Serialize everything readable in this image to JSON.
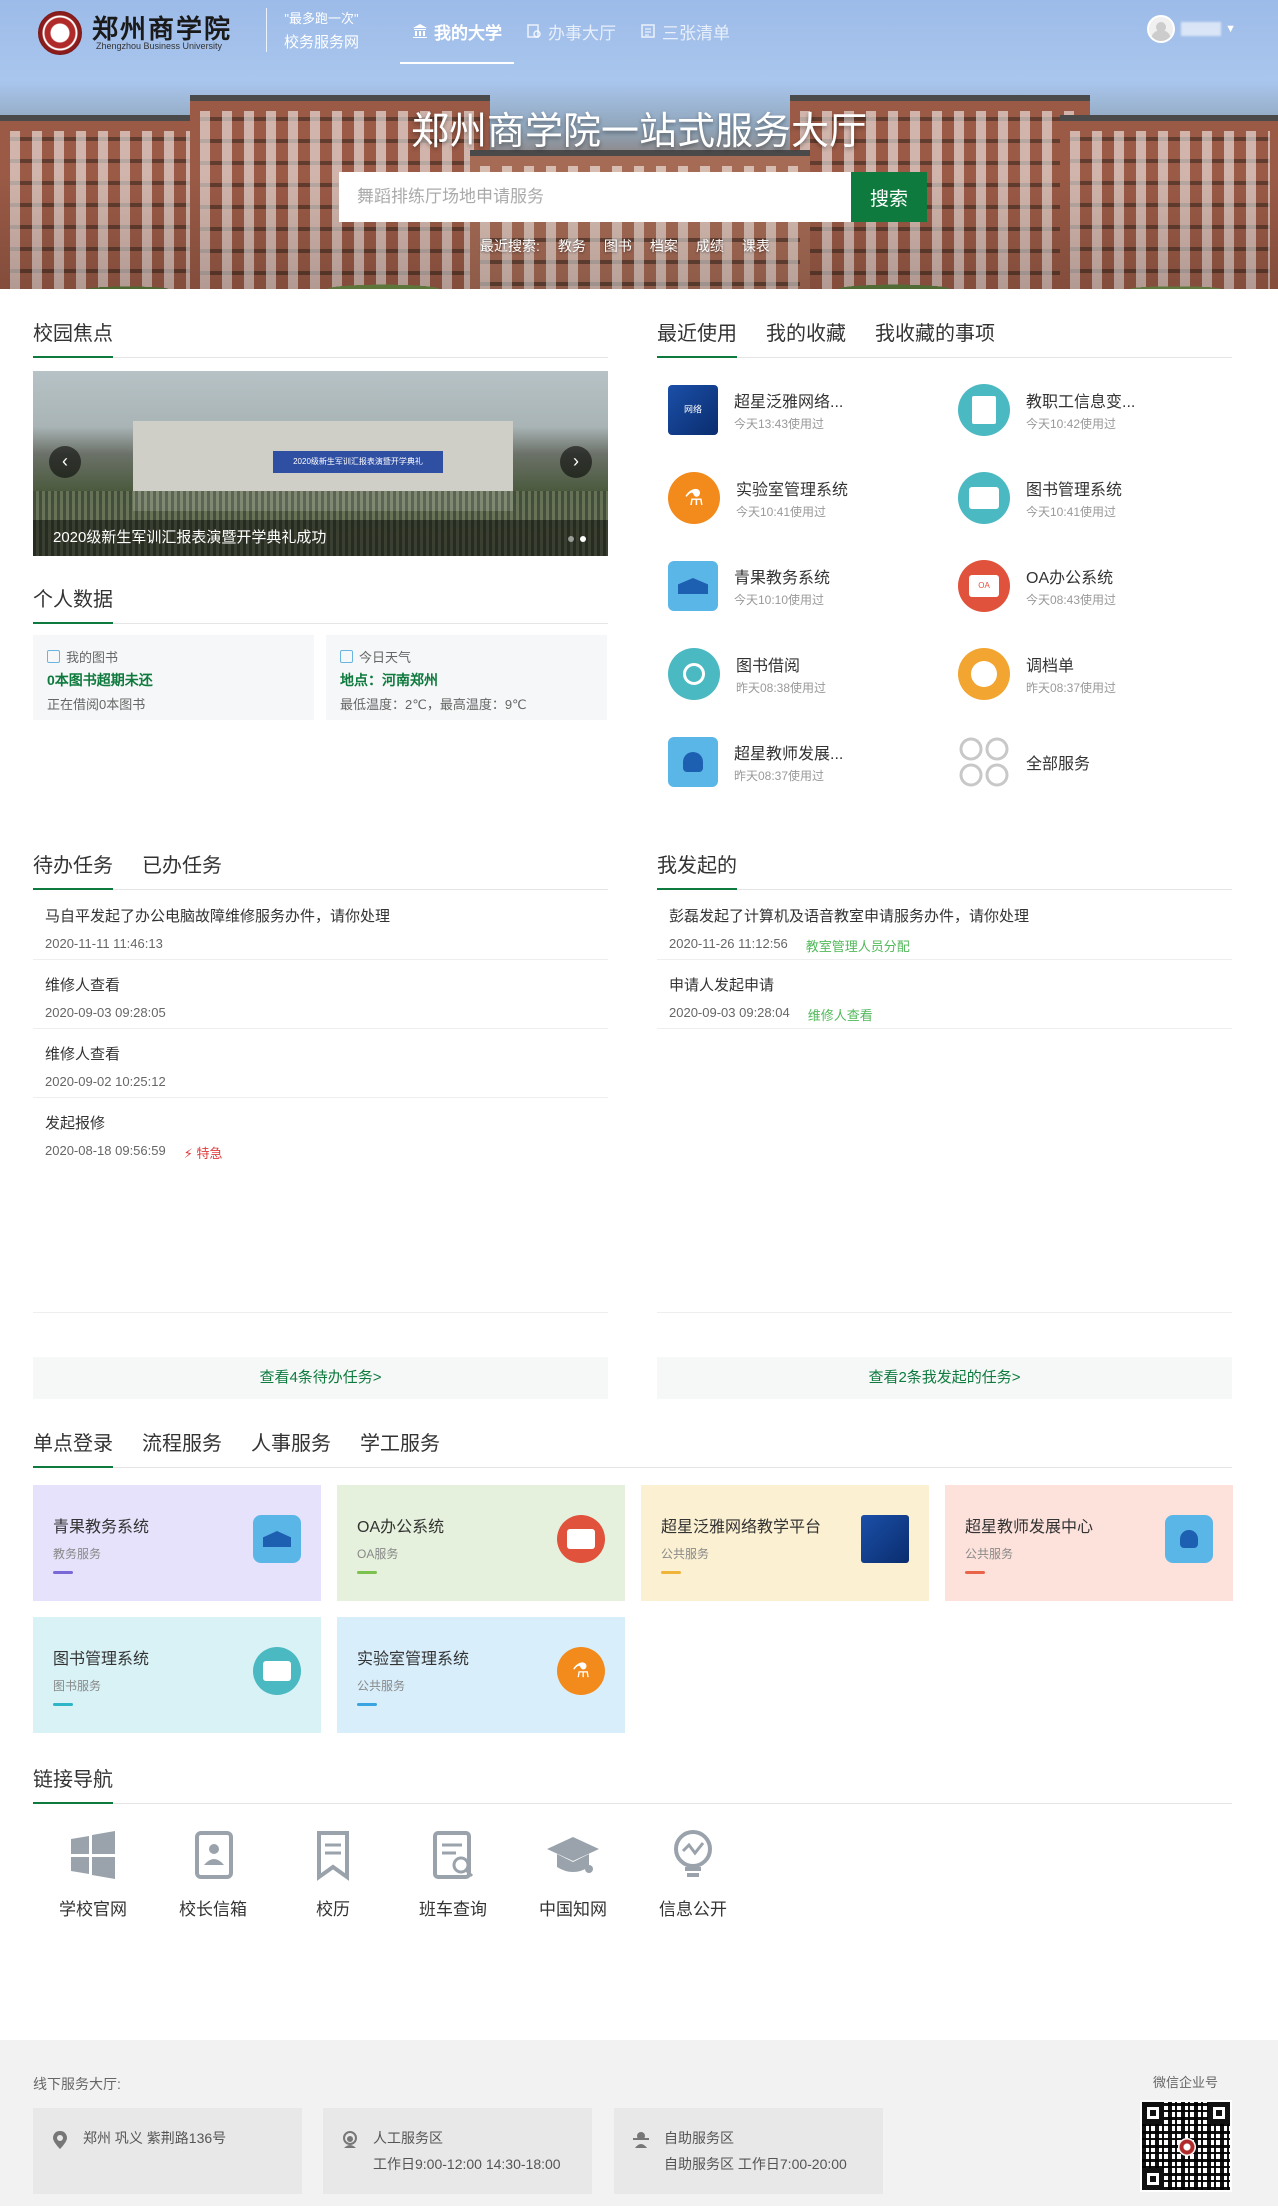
{
  "header": {
    "school_name": "郑州商学院",
    "school_name_en": "Zhengzhou Business University",
    "slogan_line1": "\"最多跑一次\"",
    "slogan_line2": "校务服务网",
    "tabs": [
      {
        "label": "我的大学",
        "icon": "university-icon",
        "active": true
      },
      {
        "label": "办事大厅",
        "icon": "hall-icon",
        "active": false
      },
      {
        "label": "三张清单",
        "icon": "list-icon",
        "active": false
      }
    ]
  },
  "hero": {
    "title": "郑州商学院一站式服务大厅",
    "search_placeholder": "舞蹈排练厅场地申请服务",
    "search_button": "搜索",
    "recent_label": "最近搜索:",
    "recent_terms": [
      "教务",
      "图书",
      "档案",
      "成绩",
      "课表"
    ]
  },
  "campus_focus": {
    "title": "校园焦点",
    "caption": "2020级新生军训汇报表演暨开学典礼成功",
    "banner_text": "2020级新生军训汇报表演暨开学典礼"
  },
  "personal_data": {
    "title": "个人数据",
    "library": {
      "header": "我的图书",
      "main": "0本图书超期未还",
      "sub": "正在借阅0本图书"
    },
    "weather": {
      "header": "今日天气",
      "main": "地点：河南郑州",
      "sub": "最低温度：2℃，最高温度：9℃"
    }
  },
  "recent_use": {
    "tabs": [
      "最近使用",
      "我的收藏",
      "我收藏的事项"
    ],
    "apps": [
      {
        "name": "超星泛雅网络...",
        "time": "今天13:43使用过",
        "icon": "chaoxing-platform-icon",
        "color": "#1b4fa8"
      },
      {
        "name": "教职工信息变...",
        "time": "今天10:42使用过",
        "icon": "staff-info-icon",
        "color": "#4ab9c1"
      },
      {
        "name": "实验室管理系统",
        "time": "今天10:41使用过",
        "icon": "lab-flask-icon",
        "color": "#f28a1c"
      },
      {
        "name": "图书管理系统",
        "time": "今天10:41使用过",
        "icon": "book-search-icon",
        "color": "#4ab9c1"
      },
      {
        "name": "青果教务系统",
        "time": "今天10:10使用过",
        "icon": "graduation-cap-icon",
        "color": "#5bb6e8"
      },
      {
        "name": "OA办公系统",
        "time": "今天08:43使用过",
        "icon": "oa-mail-icon",
        "color": "#e0523c"
      },
      {
        "name": "图书借阅",
        "time": "昨天08:38使用过",
        "icon": "book-borrow-icon",
        "color": "#4ab9c1"
      },
      {
        "name": "调档单",
        "time": "昨天08:37使用过",
        "icon": "archive-transfer-icon",
        "color": "#f2a530"
      },
      {
        "name": "超星教师发展...",
        "time": "昨天08:37使用过",
        "icon": "teacher-dev-icon",
        "color": "#5bb6e8"
      },
      {
        "name": "全部服务",
        "time": "",
        "icon": "all-services-icon",
        "color": "#cccccc"
      }
    ]
  },
  "todo": {
    "tabs": [
      "待办任务",
      "已办任务"
    ],
    "items": [
      {
        "title": "马自平发起了办公电脑故障维修服务办件，请你处理",
        "date": "2020-11-11 11:46:13",
        "tag": ""
      },
      {
        "title": "维修人查看",
        "date": "2020-09-03 09:28:05",
        "tag": ""
      },
      {
        "title": "维修人查看",
        "date": "2020-09-02 10:25:12",
        "tag": ""
      },
      {
        "title": "发起报修",
        "date": "2020-08-18 09:56:59",
        "tag": "特急"
      }
    ],
    "more": "查看4条待办任务>"
  },
  "initiated": {
    "title": "我发起的",
    "items": [
      {
        "title": "彭磊发起了计算机及语音教室申请服务办件，请你处理",
        "date": "2020-11-26 11:12:56",
        "status": "教室管理人员分配"
      },
      {
        "title": "申请人发起申请",
        "date": "2020-09-03 09:28:04",
        "status": "维修人查看"
      }
    ],
    "more": "查看2条我发起的任务>"
  },
  "sso": {
    "tabs": [
      "单点登录",
      "流程服务",
      "人事服务",
      "学工服务"
    ],
    "cards": [
      {
        "name": "青果教务系统",
        "category": "教务服务",
        "bg": "#e6e2fb",
        "bar": "#7b68d8",
        "icon": "graduation-cap-icon",
        "icon_bg": "#5bb6e8"
      },
      {
        "name": "OA办公系统",
        "category": "OA服务",
        "bg": "#e5f1dc",
        "bar": "#7cc24e",
        "icon": "oa-mail-icon",
        "icon_bg": "#e0523c"
      },
      {
        "name": "超星泛雅网络教学平台",
        "category": "公共服务",
        "bg": "#fbf0d2",
        "bar": "#f0b43a",
        "icon": "chaoxing-platform-icon",
        "icon_bg": "#1b4fa8"
      },
      {
        "name": "超星教师发展中心",
        "category": "公共服务",
        "bg": "#fde2dc",
        "bar": "#e8654a",
        "icon": "teacher-dev-icon",
        "icon_bg": "#5bb6e8"
      },
      {
        "name": "图书管理系统",
        "category": "图书服务",
        "bg": "#d8f2f6",
        "bar": "#2fb5c8",
        "icon": "book-search-icon",
        "icon_bg": "#4ab9c1"
      },
      {
        "name": "实验室管理系统",
        "category": "公共服务",
        "bg": "#d8eefb",
        "bar": "#3aa4e0",
        "icon": "lab-flask-icon",
        "icon_bg": "#f28a1c"
      }
    ]
  },
  "links": {
    "title": "链接导航",
    "items": [
      {
        "label": "学校官网",
        "icon": "windows-icon"
      },
      {
        "label": "校长信箱",
        "icon": "mailbox-icon"
      },
      {
        "label": "校历",
        "icon": "bookmark-icon"
      },
      {
        "label": "班车查询",
        "icon": "doc-search-icon"
      },
      {
        "label": "中国知网",
        "icon": "academic-cap-icon"
      },
      {
        "label": "信息公开",
        "icon": "info-bulb-icon"
      }
    ]
  },
  "footer": {
    "label": "线下服务大厅:",
    "cards": [
      {
        "title": "郑州 巩义 紫荆路136号",
        "sub": "",
        "icon": "location-pin-icon"
      },
      {
        "title": "人工服务区",
        "sub": "工作日9:00-12:00 14:30-18:00",
        "icon": "manual-service-icon"
      },
      {
        "title": "自助服务区",
        "sub": "自助服务区 工作日7:00-20:00",
        "icon": "self-service-icon"
      }
    ],
    "qr_label": "微信企业号"
  }
}
